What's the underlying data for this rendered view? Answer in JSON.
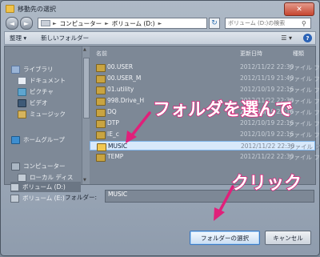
{
  "window": {
    "title": "移動先の選択",
    "close_label": "✕"
  },
  "nav_buttons": {
    "back": "◄",
    "forward": "►"
  },
  "address": {
    "crumbs": [
      "コンピューター",
      "ボリューム (D:)"
    ],
    "separator": "►"
  },
  "search": {
    "placeholder": "ボリューム (D:)の検索"
  },
  "toolbar": {
    "organize": "整理 ▾",
    "new_folder": "新しいフォルダー",
    "view": "☰ ▾",
    "help": "?"
  },
  "sidebar": {
    "items": [
      {
        "label": "ライブラリ",
        "icon": "library-icon"
      },
      {
        "label": "ドキュメント",
        "icon": "document-icon"
      },
      {
        "label": "ピクチャ",
        "icon": "picture-icon"
      },
      {
        "label": "ビデオ",
        "icon": "video-icon"
      },
      {
        "label": "ミュージック",
        "icon": "music-icon"
      },
      {
        "label": "ホームグループ",
        "icon": "homegroup-icon"
      },
      {
        "label": "コンピューター",
        "icon": "computer-icon"
      },
      {
        "label": "ローカル ディス",
        "icon": "drive-icon"
      },
      {
        "label": "ボリューム (D:)",
        "icon": "drive-icon"
      },
      {
        "label": "ボリューム (E:)",
        "icon": "drive-icon"
      }
    ]
  },
  "columns": {
    "name": "名前",
    "date": "更新日時",
    "type": "種類"
  },
  "files": [
    {
      "name": "00.USER",
      "date": "2012/11/22 22:30",
      "type": "ファイル フ"
    },
    {
      "name": "00.USER_M",
      "date": "2012/11/19 21:40",
      "type": "ファイル フ"
    },
    {
      "name": "01.utility",
      "date": "2012/10/19 22:16",
      "type": "ファイル フ"
    },
    {
      "name": "998.Drive_H",
      "date": "2012/11/22 22:30",
      "type": "ファイル フ"
    },
    {
      "name": "DQ",
      "date": "2012/10/19 22:16",
      "type": "ファイル フ"
    },
    {
      "name": "DTP",
      "date": "2012/10/19 22:16",
      "type": "ファイル フ"
    },
    {
      "name": "IE_c",
      "date": "2012/10/19 22:16",
      "type": "ファイル フ"
    },
    {
      "name": "MUSIC",
      "date": "2012/11/22 22:30",
      "type": "ファイル フ"
    },
    {
      "name": "TEMP",
      "date": "2012/11/22 22:30",
      "type": "ファイル フ"
    }
  ],
  "selected_file_index": 7,
  "annotations": {
    "choose_folder": "フォルダを選んで",
    "click": "クリック"
  },
  "footer": {
    "folder_label": "フォルダー:",
    "folder_value": "MUSIC",
    "select_button": "フォルダーの選択",
    "cancel_button": "キャンセル"
  },
  "colors": {
    "annotation_pink": "#e0207a",
    "selection": "#d8e9fb"
  }
}
